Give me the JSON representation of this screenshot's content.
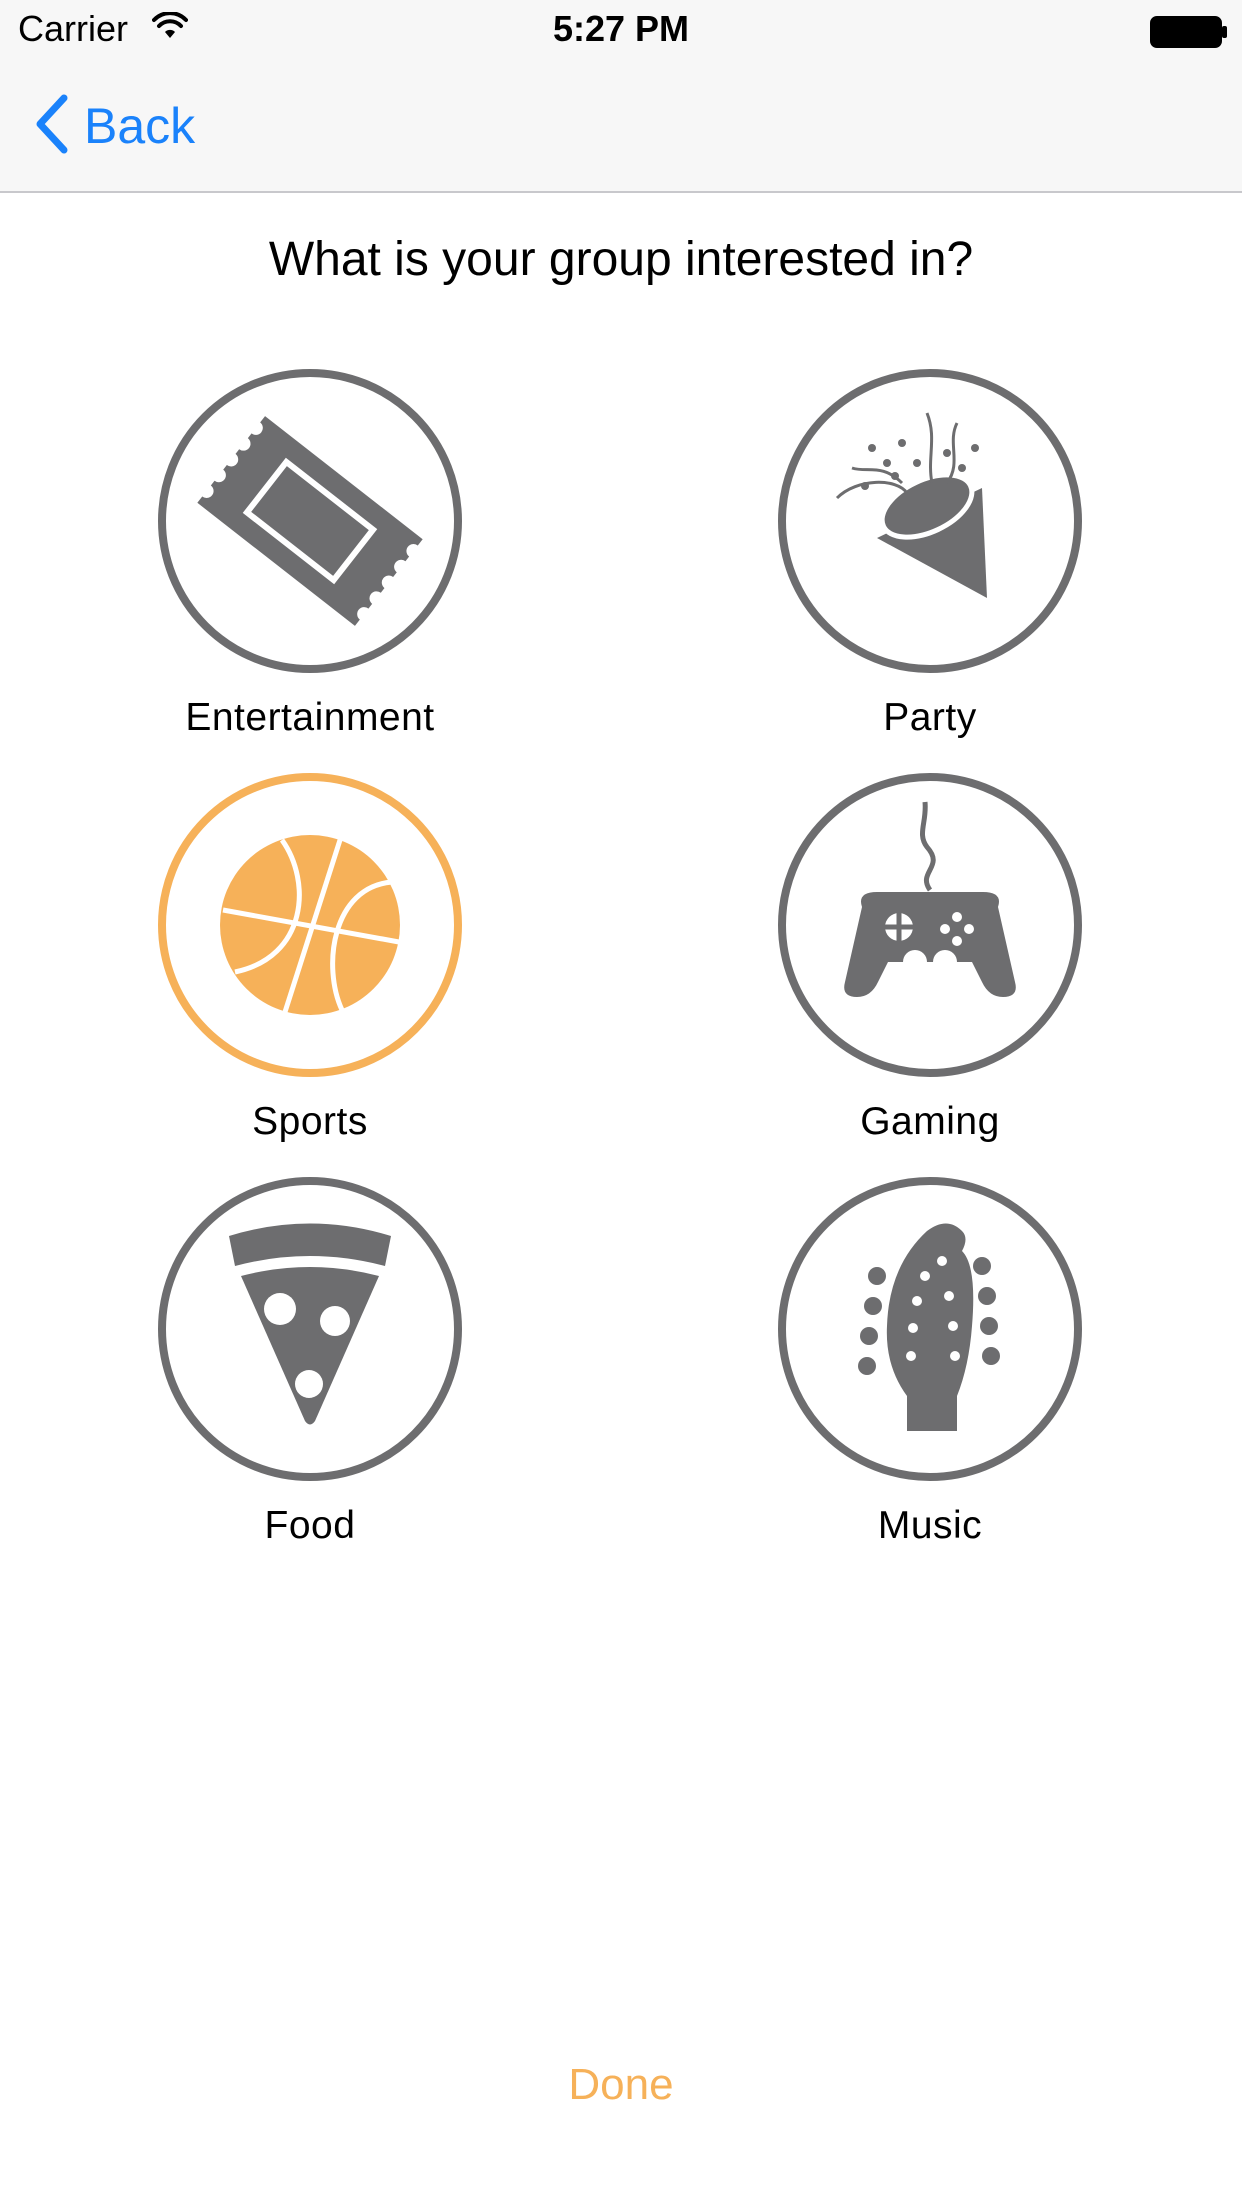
{
  "status_bar": {
    "carrier": "Carrier",
    "time": "5:27 PM"
  },
  "nav": {
    "back_label": "Back"
  },
  "prompt": "What is your group interested in?",
  "colors": {
    "icon_gray": "#6d6d6f",
    "selected_orange": "#f6b159",
    "link_blue": "#1a82fb"
  },
  "interests": [
    {
      "label": "Entertainment",
      "icon": "ticket-icon",
      "selected": false
    },
    {
      "label": "Party",
      "icon": "party-popper-icon",
      "selected": false
    },
    {
      "label": "Sports",
      "icon": "basketball-icon",
      "selected": true
    },
    {
      "label": "Gaming",
      "icon": "gamepad-icon",
      "selected": false
    },
    {
      "label": "Food",
      "icon": "pizza-icon",
      "selected": false
    },
    {
      "label": "Music",
      "icon": "guitar-headstock-icon",
      "selected": false
    }
  ],
  "done_label": "Done"
}
